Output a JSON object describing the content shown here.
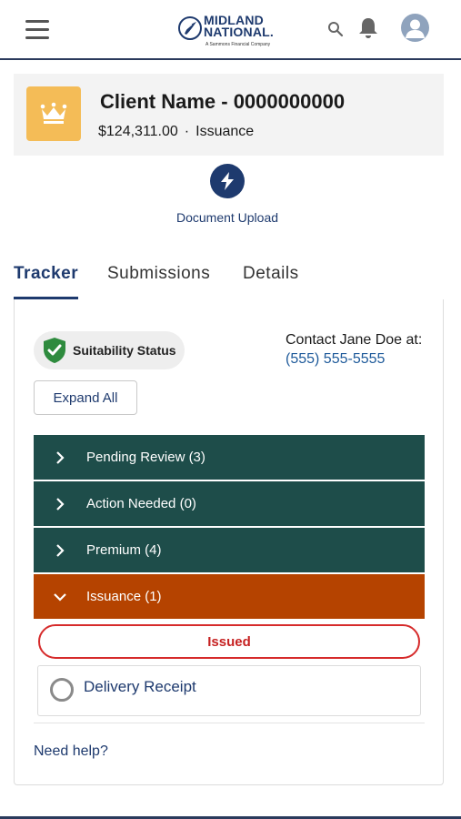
{
  "header": {
    "logo_line1": "MIDLAND",
    "logo_line2": "NATIONAL.",
    "logo_tagline": "A Sammons Financial Company",
    "icons": [
      "hamburger-menu-icon",
      "search-icon",
      "bell-icon",
      "user-avatar-icon"
    ]
  },
  "record": {
    "icon": "crown-icon",
    "client_name": "Client Name - 0000000000",
    "amount": "$124,311.00",
    "separator": "·",
    "status": "Issuance"
  },
  "actions": {
    "document_upload_label": "Document Upload",
    "icon": "lightning-bolt-icon"
  },
  "tabs": [
    {
      "label": "Tracker",
      "active": true
    },
    {
      "label": "Submissions",
      "active": false
    },
    {
      "label": "Details",
      "active": false
    }
  ],
  "tracker": {
    "suitability_label": "Suitability Status",
    "contact_prefix": "Contact Jane Doe at:",
    "contact_phone": "(555) 555-5555",
    "expand_all_label": "Expand All",
    "sections": [
      {
        "label": "Pending Review (3)",
        "expanded": false,
        "color": "#1e4d4a"
      },
      {
        "label": "Action Needed (0)",
        "expanded": false,
        "color": "#1e4d4a"
      },
      {
        "label": "Premium (4)",
        "expanded": false,
        "color": "#1e4d4a"
      },
      {
        "label": "Issuance (1)",
        "expanded": true,
        "color": "#b54300"
      }
    ],
    "issued_badge": "Issued",
    "delivery_receipt_label": "Delivery Receipt",
    "need_help_label": "Need help?"
  },
  "colors": {
    "brand_navy": "#1e3a6e",
    "section_teal": "#1e4d4a",
    "section_orange": "#b54300",
    "issued_red": "#d62b2b",
    "crown_tile": "#f4bc57",
    "suitability_green": "#2e8b3e"
  }
}
